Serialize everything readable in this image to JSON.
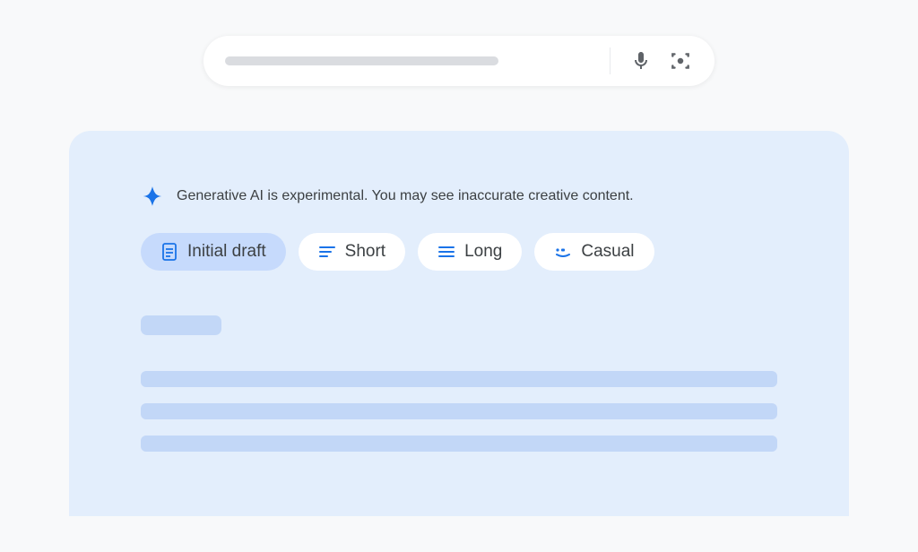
{
  "search": {
    "placeholder": ""
  },
  "ai_panel": {
    "disclaimer": "Generative AI is experimental. You may see inaccurate creative content.",
    "chips": [
      {
        "label": "Initial draft",
        "icon": "document-icon",
        "selected": true
      },
      {
        "label": "Short",
        "icon": "short-lines-icon",
        "selected": false
      },
      {
        "label": "Long",
        "icon": "long-lines-icon",
        "selected": false
      },
      {
        "label": "Casual",
        "icon": "casual-icon",
        "selected": false
      }
    ]
  }
}
